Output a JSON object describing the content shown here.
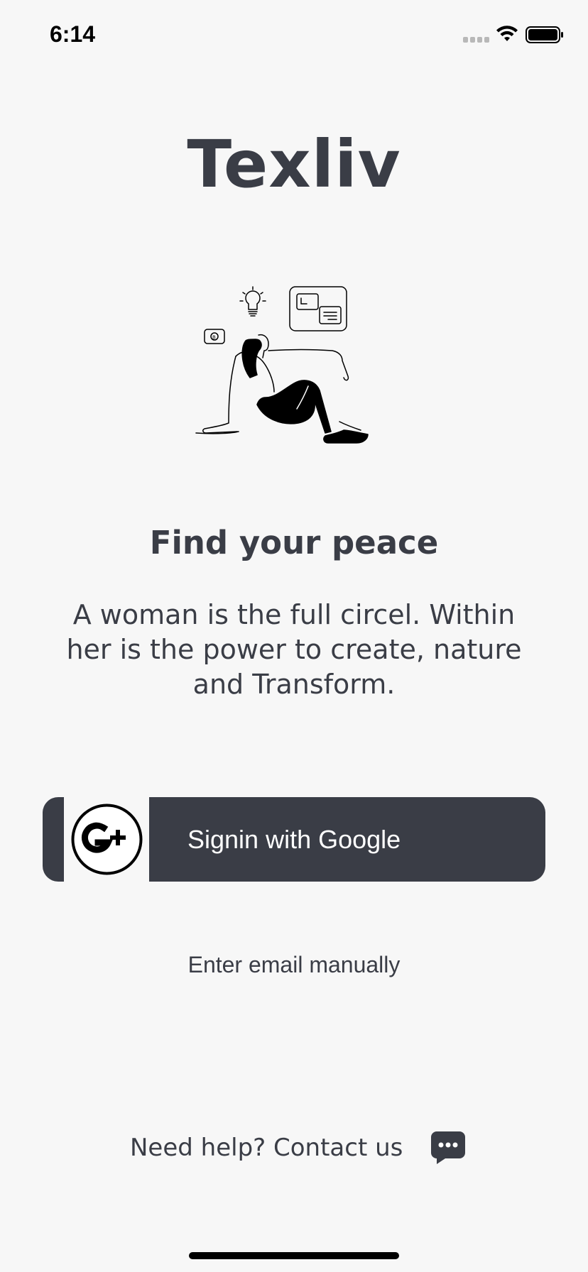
{
  "status_bar": {
    "time": "6:14",
    "signal_icon": "cellular-signal-icon",
    "wifi_icon": "wifi-icon",
    "battery_icon": "battery-full-icon"
  },
  "app": {
    "title": "Texliv"
  },
  "illustration": {
    "icon": "woman-sitting-thinking-illustration"
  },
  "intro": {
    "headline": "Find your peace",
    "tagline": "A woman is the full circel. Within her is the power to create, nature and Transform."
  },
  "google_button": {
    "label": "Signin with Google",
    "icon": "google-plus-icon"
  },
  "manual_email": {
    "label": "Enter email manually"
  },
  "help": {
    "label": "Need help? Contact us",
    "icon": "chat-bubble-icon"
  },
  "colors": {
    "primary": "#3a3d46",
    "background": "#f7f7f7",
    "button_text": "#ffffff"
  }
}
